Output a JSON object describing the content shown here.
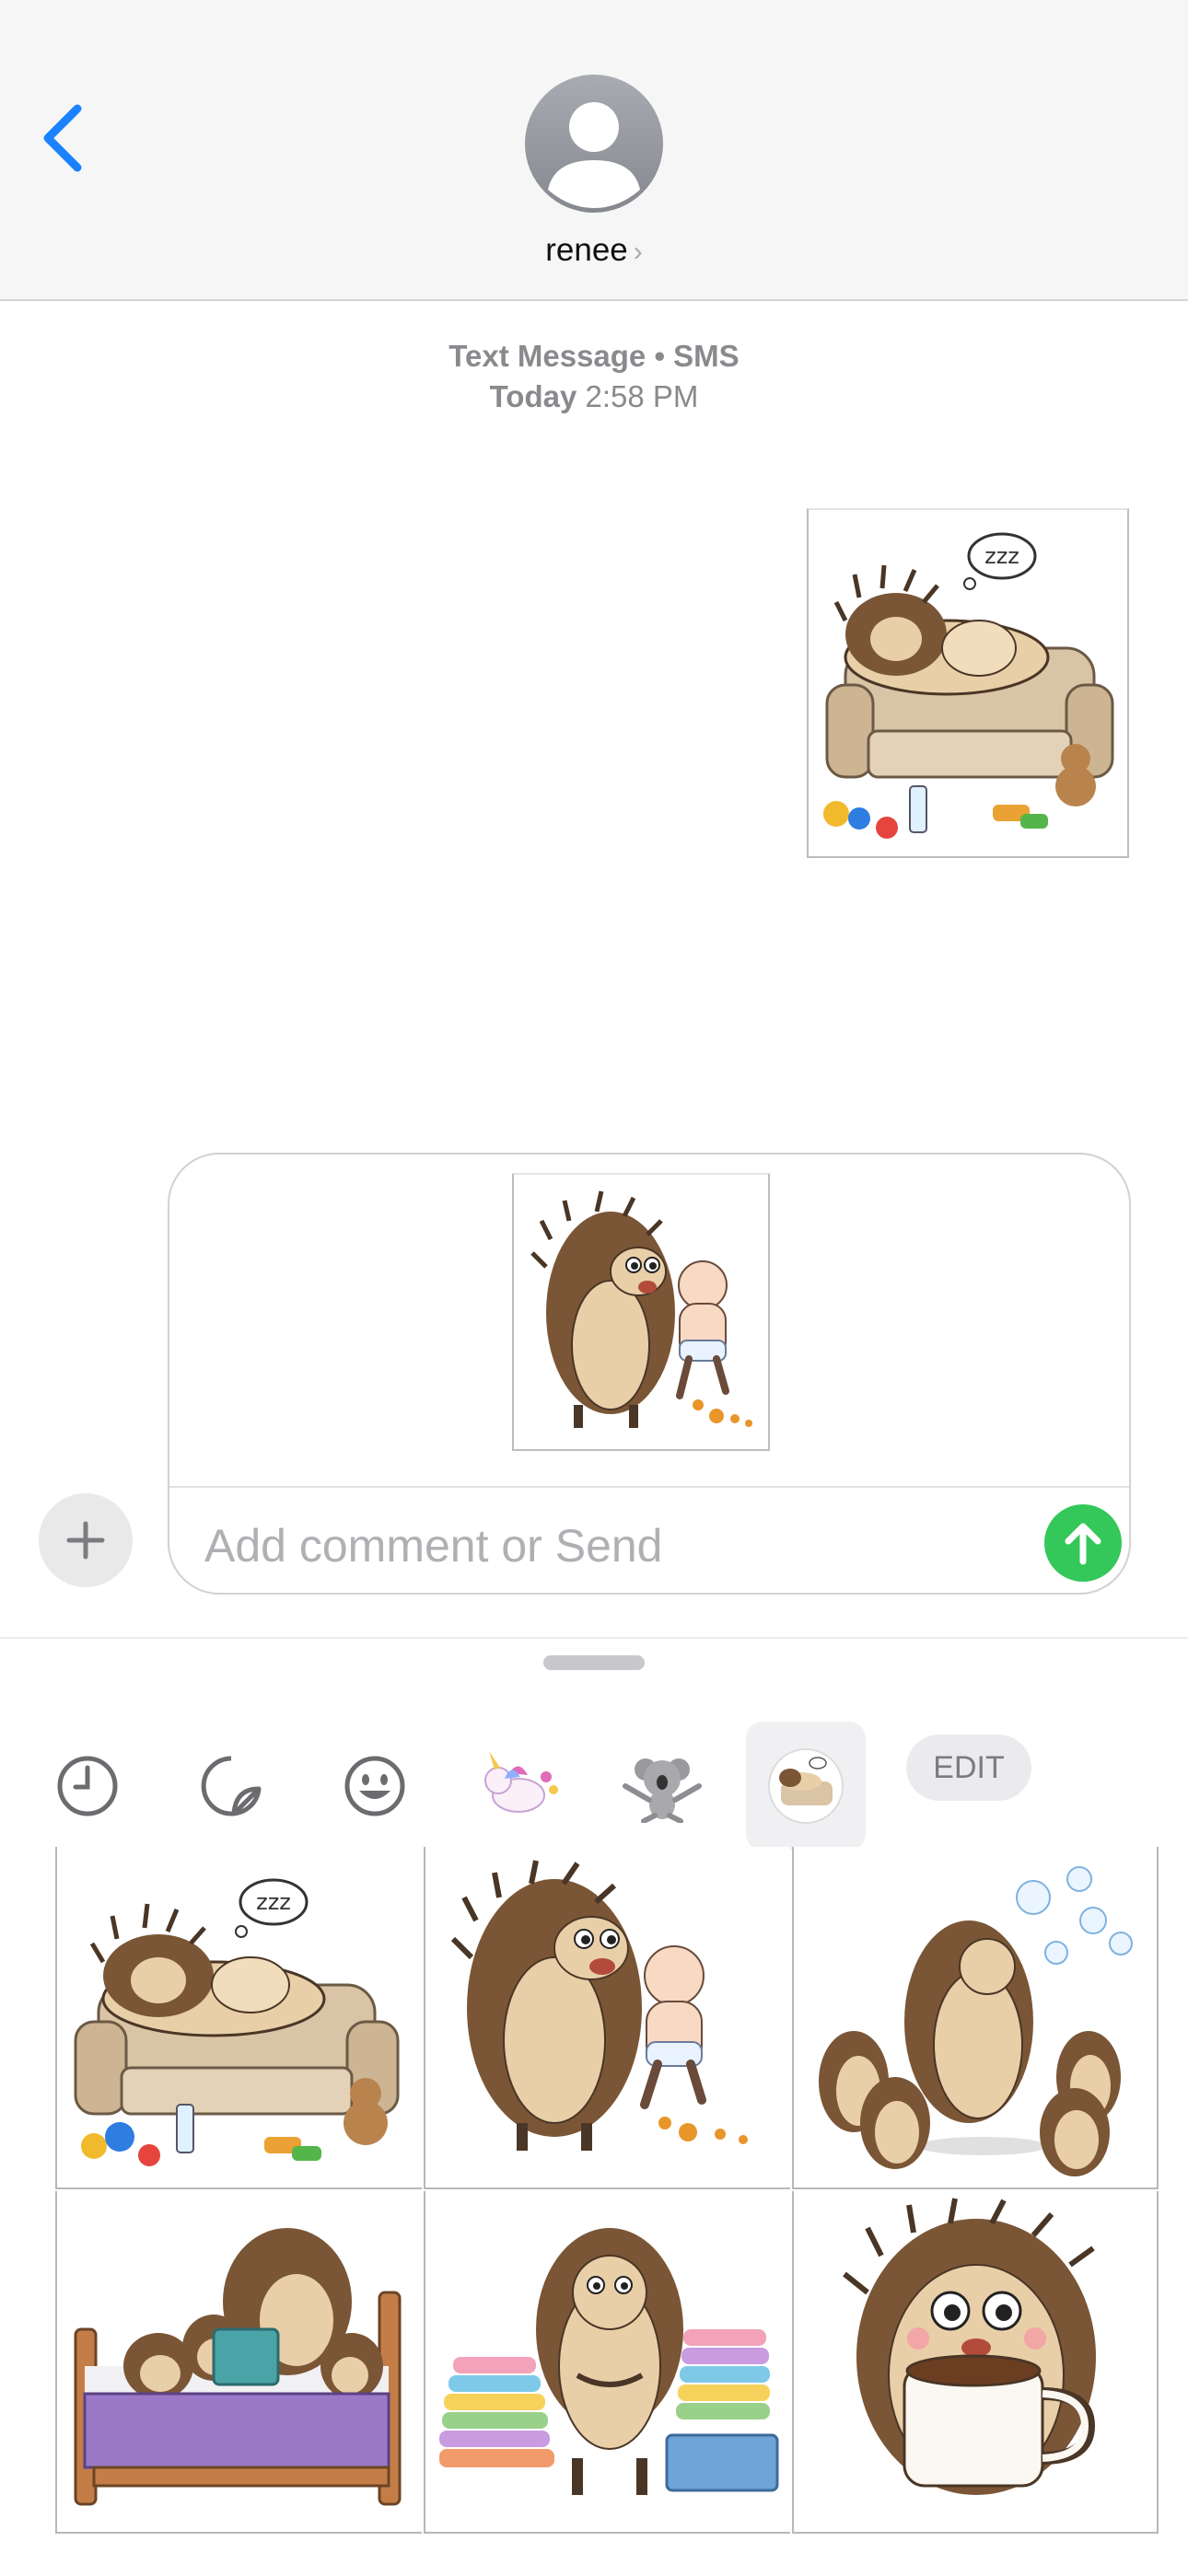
{
  "header": {
    "contact_name": "renee",
    "contact_chevron": "›"
  },
  "thread": {
    "service_label": "Text Message • SMS",
    "date_prefix": "Today",
    "time": "2:58 PM"
  },
  "composer": {
    "placeholder": "Add comment or Send"
  },
  "drawer": {
    "tabs": [
      "clock-icon",
      "sticker-peel-icon",
      "emoji-smile-icon",
      "unicorn-sticker-pack",
      "koala-sticker-pack",
      "hedgehog-sticker-pack"
    ],
    "edit_label": "EDIT",
    "stickers": [
      "hedgehog-sleeping-on-couch",
      "hedgehog-holding-baby",
      "hedgehog-blowing-bubbles",
      "hedgehog-reading-bedtime-story",
      "hedgehog-laundry-piles",
      "hedgehog-coffee-mug"
    ]
  },
  "colors": {
    "accent_blue": "#1a82ff",
    "send_green": "#34c759",
    "hedgehog_body": "#e9cfa8",
    "hedgehog_spines": "#7a5636"
  }
}
